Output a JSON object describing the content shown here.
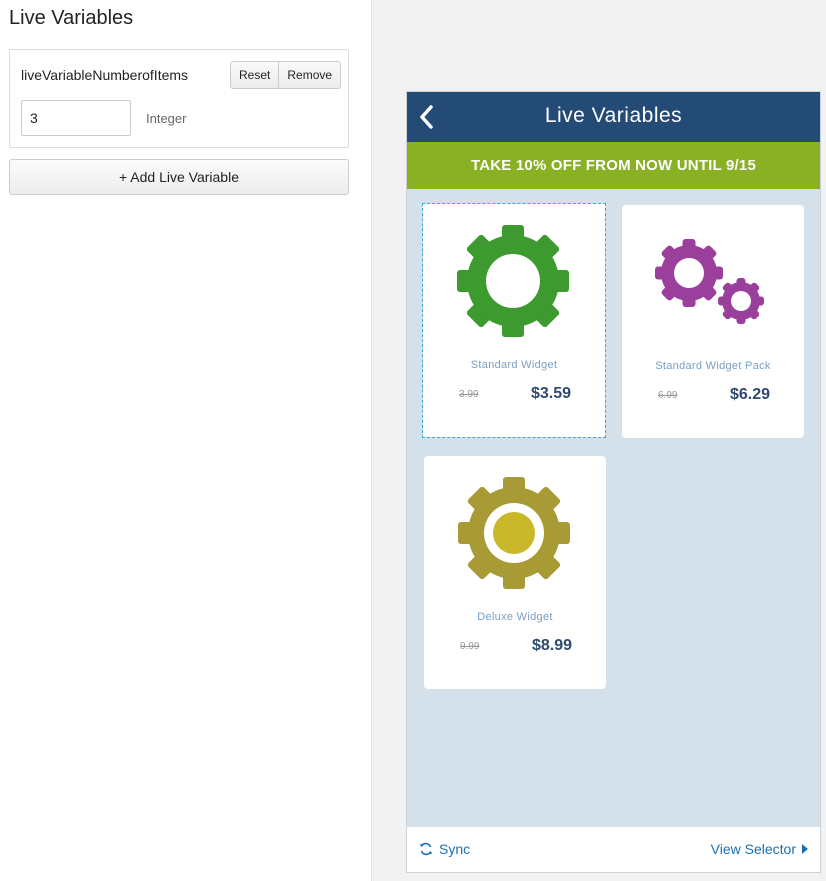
{
  "left_panel": {
    "title": "Live Variables",
    "variable": {
      "name": "liveVariableNumberofItems",
      "reset_label": "Reset",
      "remove_label": "Remove",
      "value": "3",
      "type": "Integer"
    },
    "add_label": "+ Add Live Variable"
  },
  "app": {
    "title": "Live Variables",
    "promo": "TAKE 10% OFF FROM NOW UNTIL 9/15",
    "products": [
      {
        "name": "Standard Widget",
        "old_price": "3.99",
        "price": "$3.59",
        "icon": "green-gear-icon",
        "color": "#3c9a2e"
      },
      {
        "name": "Standard Widget Pack",
        "old_price": "6.99",
        "price": "$6.29",
        "icon": "purple-gears-icon",
        "color": "#9a3f9c"
      },
      {
        "name": "Deluxe Widget",
        "old_price": "9.99",
        "price": "$8.99",
        "icon": "gold-gear-icon",
        "color": "#a89a34"
      }
    ],
    "footer": {
      "sync_label": "Sync",
      "view_selector_label": "View Selector"
    }
  },
  "colors": {
    "header_bg": "#244a76",
    "promo_bg": "#8ab024",
    "link": "#1a6fb3"
  }
}
